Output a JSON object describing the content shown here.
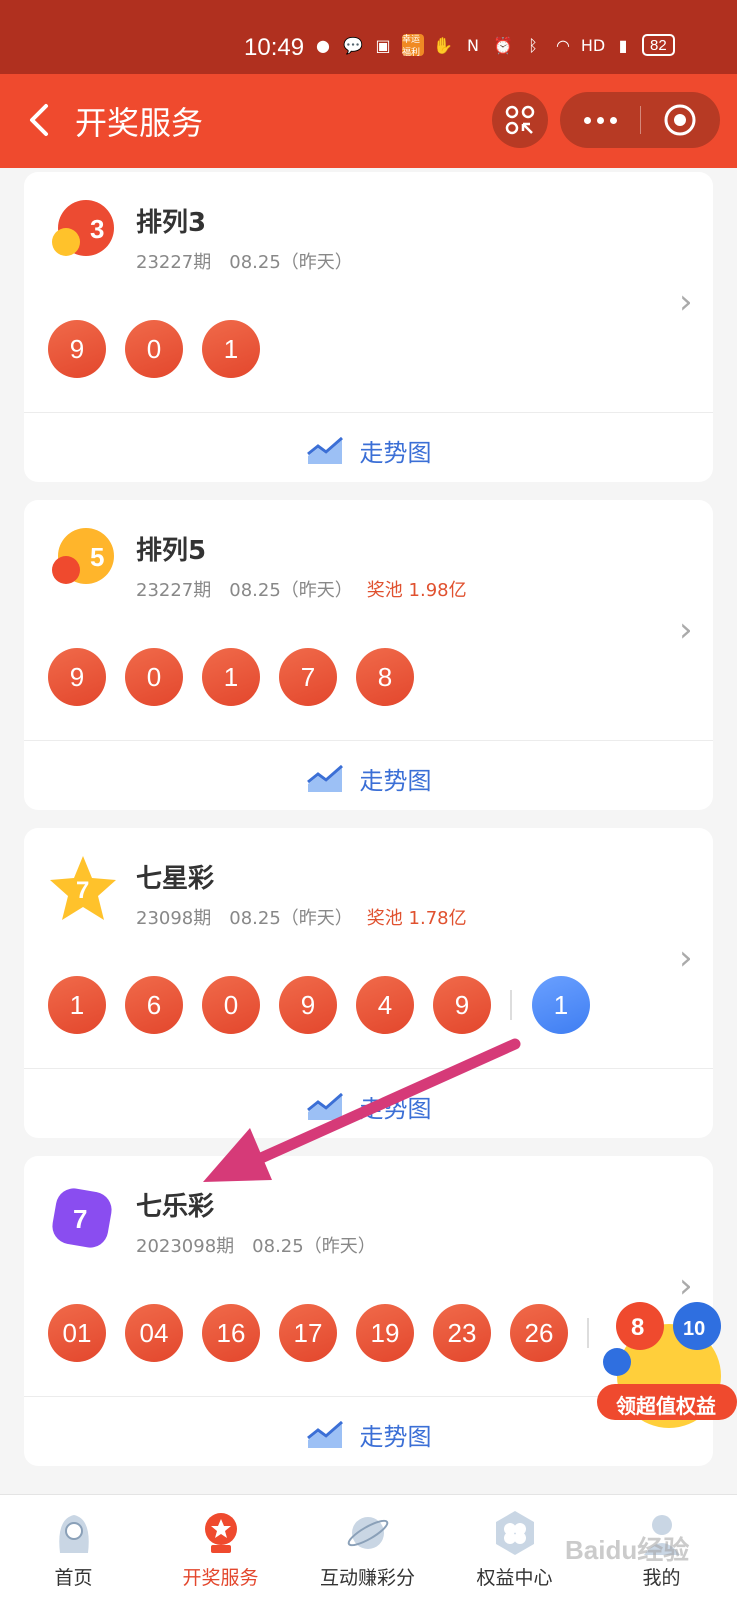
{
  "status": {
    "time": "10:49",
    "battery": "82",
    "badge": "幸运福利"
  },
  "nav": {
    "title": "开奖服务"
  },
  "cards": [
    {
      "name": "排列3",
      "issue": "23227期",
      "date": "08.25（昨天）",
      "pool": "",
      "logo_number": "3",
      "balls": [
        "9",
        "0",
        "1"
      ],
      "extra_balls": [],
      "trend_label": "走势图"
    },
    {
      "name": "排列5",
      "issue": "23227期",
      "date": "08.25（昨天）",
      "pool": "奖池 1.98亿",
      "logo_number": "5",
      "balls": [
        "9",
        "0",
        "1",
        "7",
        "8"
      ],
      "extra_balls": [],
      "trend_label": "走势图"
    },
    {
      "name": "七星彩",
      "issue": "23098期",
      "date": "08.25（昨天）",
      "pool": "奖池 1.78亿",
      "logo_number": "7",
      "balls": [
        "1",
        "6",
        "0",
        "9",
        "4",
        "9"
      ],
      "extra_balls": [
        "1"
      ],
      "trend_label": "走势图"
    },
    {
      "name": "七乐彩",
      "issue": "2023098期",
      "date": "08.25（昨天）",
      "pool": "",
      "logo_number": "7",
      "balls": [
        "01",
        "04",
        "16",
        "17",
        "19",
        "23",
        "26"
      ],
      "extra_balls": [],
      "trend_label": "走势图"
    }
  ],
  "promo": {
    "label": "领超值权益"
  },
  "tabs": [
    {
      "label": "首页",
      "icon": "home-icon"
    },
    {
      "label": "开奖服务",
      "icon": "lottery-machine-icon"
    },
    {
      "label": "互动赚彩分",
      "icon": "planet-icon"
    },
    {
      "label": "权益中心",
      "icon": "clover-icon"
    },
    {
      "label": "我的",
      "icon": "profile-icon"
    }
  ],
  "watermark": "Baidu经验",
  "colors": {
    "brand": "#ef4a2e",
    "ball_red": "#e3472d",
    "ball_blue": "#3f7ef2",
    "trend_blue": "#3b6fd6",
    "pool_text": "#e0512f"
  }
}
